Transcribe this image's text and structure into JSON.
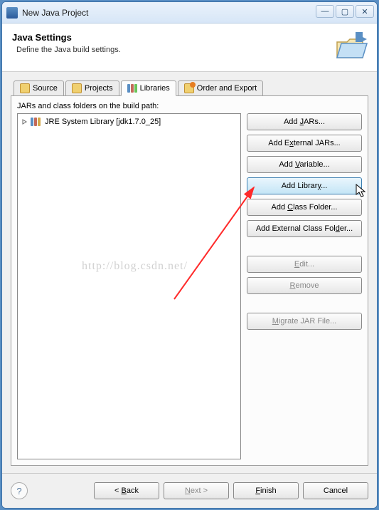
{
  "window": {
    "title": "New Java Project"
  },
  "header": {
    "title": "Java Settings",
    "subtitle": "Define the Java build settings."
  },
  "tabs": {
    "items": [
      {
        "label": "Source"
      },
      {
        "label": "Projects"
      },
      {
        "label": "Libraries"
      },
      {
        "label": "Order and Export"
      }
    ],
    "active_index": 2
  },
  "list": {
    "label": "JARs and class folders on the build path:",
    "items": [
      {
        "label": "JRE System Library [jdk1.7.0_25]"
      }
    ]
  },
  "buttons": {
    "add_jars": {
      "pre": "Add ",
      "u": "J",
      "post": "ARs..."
    },
    "add_ext_jars": {
      "pre": "Add E",
      "u": "x",
      "post": "ternal JARs..."
    },
    "add_variable": {
      "pre": "Add ",
      "u": "V",
      "post": "ariable..."
    },
    "add_library": {
      "pre": "Add Librar",
      "u": "y",
      "post": "..."
    },
    "add_class_folder": {
      "pre": "Add ",
      "u": "C",
      "post": "lass Folder..."
    },
    "add_ext_class_folder": {
      "pre": "Add External Class Fol",
      "u": "d",
      "post": "er..."
    },
    "edit": {
      "pre": "",
      "u": "E",
      "post": "dit..."
    },
    "remove": {
      "pre": "",
      "u": "R",
      "post": "emove"
    },
    "migrate": {
      "pre": "",
      "u": "M",
      "post": "igrate JAR File..."
    }
  },
  "footer": {
    "back": {
      "pre": "< ",
      "u": "B",
      "post": "ack"
    },
    "next": {
      "pre": "",
      "u": "N",
      "post": "ext >"
    },
    "finish": {
      "pre": "",
      "u": "F",
      "post": "inish"
    },
    "cancel": "Cancel"
  },
  "watermark": "http://blog.csdn.net/"
}
